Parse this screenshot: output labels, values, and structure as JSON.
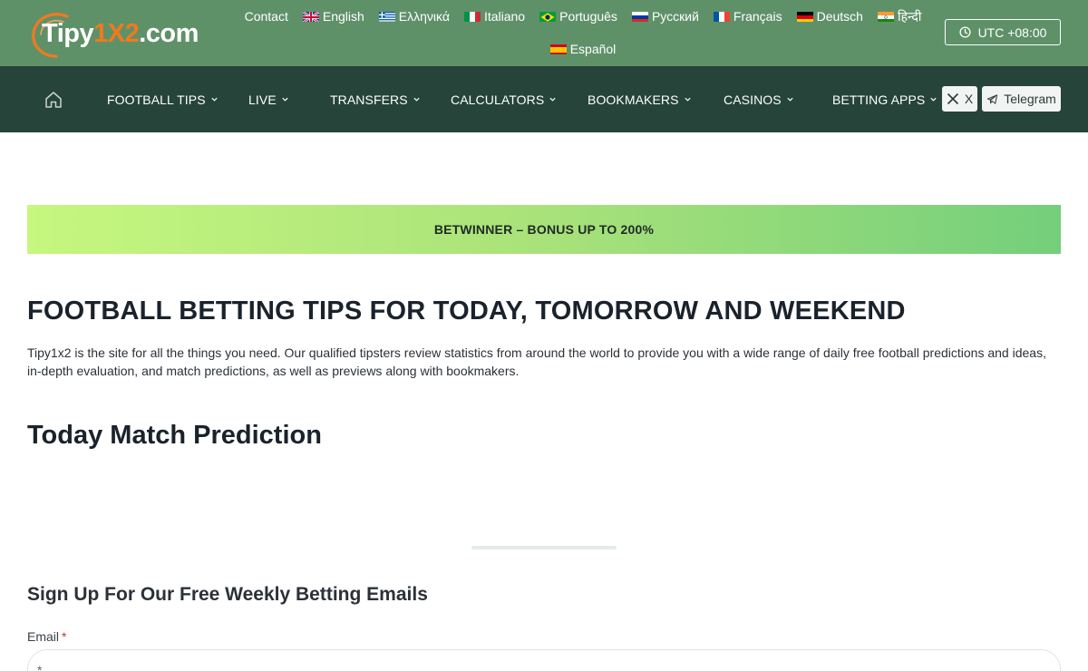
{
  "topbar": {
    "logo": {
      "part1": "Tipy",
      "part2": "1X2",
      "part3": ".com"
    },
    "contact_label": "Contact",
    "languages": [
      {
        "label": "English",
        "icon": "uk-flag-icon"
      },
      {
        "label": "Ελληνικά",
        "icon": "greece-flag-icon"
      },
      {
        "label": "Italiano",
        "icon": "italy-flag-icon"
      },
      {
        "label": "Português",
        "icon": "brazil-flag-icon"
      },
      {
        "label": "Русский",
        "icon": "russia-flag-icon"
      },
      {
        "label": "Français",
        "icon": "france-flag-icon"
      },
      {
        "label": "Deutsch",
        "icon": "germany-flag-icon"
      },
      {
        "label": "हिन्दी",
        "icon": "india-flag-icon"
      },
      {
        "label": "Español",
        "icon": "spain-flag-icon"
      }
    ],
    "utc_label": "UTC +08:00"
  },
  "nav": {
    "items": [
      {
        "label": "FOOTBALL TIPS"
      },
      {
        "label": "LIVE"
      },
      {
        "label": "TRANSFERS"
      },
      {
        "label": "CALCULATORS"
      },
      {
        "label": "BOOKMAKERS"
      },
      {
        "label": "CASINOS"
      },
      {
        "label": "BETTING APPS"
      }
    ],
    "x_label": "X",
    "telegram_label": "Telegram"
  },
  "banner": {
    "text": "BETWINNER – BONUS UP TO 200%"
  },
  "main": {
    "title": "FOOTBALL BETTING TIPS FOR TODAY, TOMORROW AND WEEKEND",
    "intro": "Tipy1x2 is the site for all the things you need. Our qualified tipsters review statistics from around the world to provide you with a wide range of daily free football predictions and ideas, in-depth evaluation, and match predictions, as well as previews along with bookmakers.",
    "today_title": "Today Match Prediction",
    "signup_title": "Sign Up For Our Free Weekly Betting Emails",
    "email_label": "Email",
    "email_required_mark": "*",
    "email_placeholder": "*"
  },
  "colors": {
    "topbar_bg": "#5f9169",
    "nav_bg": "#264439",
    "logo_accent": "#f07a1e",
    "banner_start": "#c6f77f",
    "banner_end": "#74cf7b"
  }
}
